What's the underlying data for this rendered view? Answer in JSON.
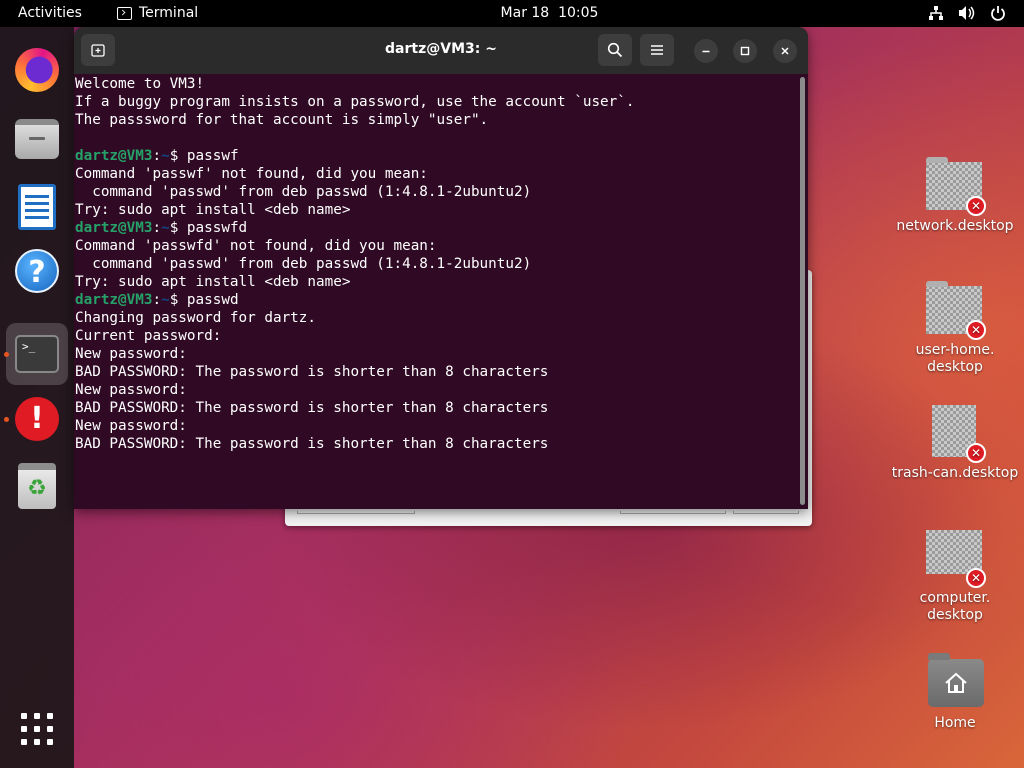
{
  "topbar": {
    "activities": "Activities",
    "app_name": "Terminal",
    "clock": "Mar 18  10:05",
    "tray_icons": [
      "network-icon",
      "volume-icon",
      "power-icon"
    ]
  },
  "dock": {
    "items": [
      {
        "name": "firefox",
        "icon": "firefox-icon"
      },
      {
        "name": "files",
        "icon": "files-icon"
      },
      {
        "name": "libreoffice-writer",
        "icon": "writer-icon"
      },
      {
        "name": "help",
        "icon": "help-icon"
      },
      {
        "name": "terminal",
        "icon": "terminal-icon",
        "active": true
      },
      {
        "name": "software-updater",
        "icon": "alert-icon"
      },
      {
        "name": "trash",
        "icon": "trash-icon"
      }
    ],
    "help_glyph": "?",
    "alert_glyph": "!",
    "terminal_glyph": ">_",
    "trash_glyph": "♻"
  },
  "terminal": {
    "title": "dartz@VM3: ~",
    "prompt": {
      "user": "dartz@VM3",
      "sep": ":",
      "path": "~",
      "symbol": "$ "
    },
    "lines": [
      {
        "type": "text",
        "text": "Welcome to VM3!"
      },
      {
        "type": "text",
        "text": "If a buggy program insists on a password, use the account `user`."
      },
      {
        "type": "text",
        "text": "The passsword for that account is simply \"user\"."
      },
      {
        "type": "text",
        "text": ""
      },
      {
        "type": "prompt",
        "cmd": "passwf"
      },
      {
        "type": "text",
        "text": "Command 'passwf' not found, did you mean:"
      },
      {
        "type": "text",
        "text": "  command 'passwd' from deb passwd (1:4.8.1-2ubuntu2)"
      },
      {
        "type": "text",
        "text": "Try: sudo apt install <deb name>"
      },
      {
        "type": "prompt",
        "cmd": "passwfd"
      },
      {
        "type": "text",
        "text": "Command 'passwfd' not found, did you mean:"
      },
      {
        "type": "text",
        "text": "  command 'passwd' from deb passwd (1:4.8.1-2ubuntu2)"
      },
      {
        "type": "text",
        "text": "Try: sudo apt install <deb name>"
      },
      {
        "type": "prompt",
        "cmd": "passwd"
      },
      {
        "type": "text",
        "text": "Changing password for dartz."
      },
      {
        "type": "text",
        "text": "Current password:"
      },
      {
        "type": "text",
        "text": "New password:"
      },
      {
        "type": "text",
        "text": "BAD PASSWORD: The password is shorter than 8 characters"
      },
      {
        "type": "text",
        "text": "New password:"
      },
      {
        "type": "text",
        "text": "BAD PASSWORD: The password is shorter than 8 characters"
      },
      {
        "type": "text",
        "text": "New password:"
      },
      {
        "type": "text",
        "text": "BAD PASSWORD: The password is shorter than 8 characters"
      }
    ]
  },
  "desktop": {
    "network": {
      "label": "network.desktop"
    },
    "user_home": {
      "label_1": "user-home.",
      "label_2": "desktop"
    },
    "trash_can": {
      "label": "trash-can.desktop"
    },
    "computer": {
      "label_1": "computer.",
      "label_2": "desktop"
    },
    "home": {
      "label": "Home"
    },
    "error_glyph": "✕"
  }
}
